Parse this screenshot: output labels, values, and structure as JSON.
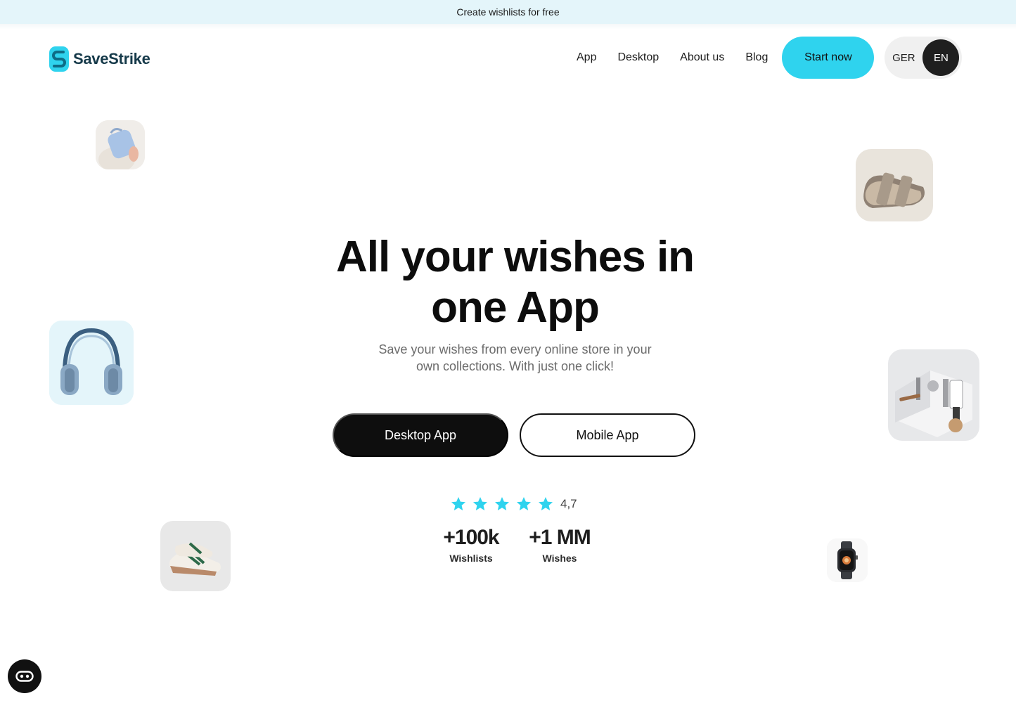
{
  "announcement": "Create wishlists for free",
  "brand": {
    "name": "SaveStrike",
    "accent": "#2fd3ee"
  },
  "nav": {
    "links": [
      "App",
      "Desktop",
      "About us",
      "Blog"
    ],
    "cta": "Start now",
    "languages": {
      "inactive": "GER",
      "active": "EN"
    }
  },
  "hero": {
    "title_line1": "All your wishes in",
    "title_line2": "one App",
    "subtitle": "Save your wishes from every online store in your own collections. With just one click!",
    "primary_button": "Desktop App",
    "secondary_button": "Mobile App"
  },
  "rating": {
    "stars": 5,
    "value": "4,7"
  },
  "stats": [
    {
      "number": "+100k",
      "label": "Wishlists"
    },
    {
      "number": "+1 MM",
      "label": "Wishes"
    }
  ],
  "product_tiles": [
    "bag-image",
    "sandals-image",
    "headphones-image",
    "coffee-machine-image",
    "sneakers-image",
    "smartwatch-image"
  ],
  "chat_widget_icon": "chat-icon"
}
